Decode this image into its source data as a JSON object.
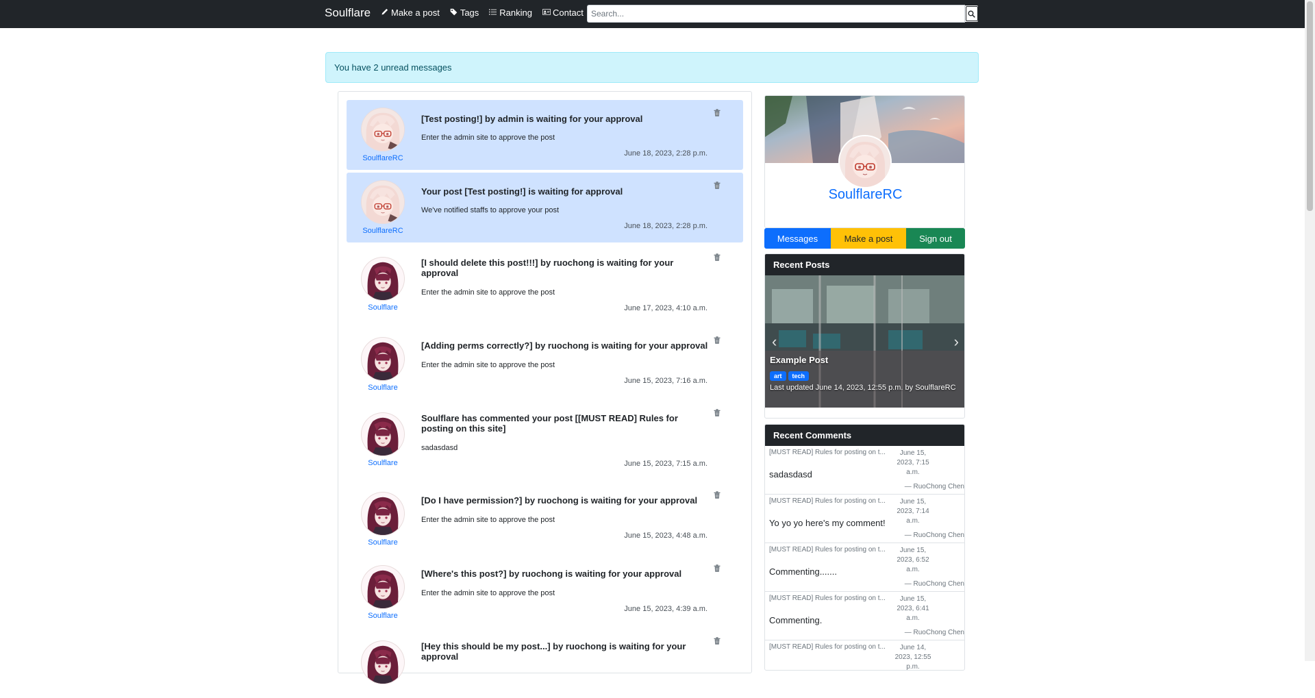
{
  "navbar": {
    "brand": "Soulflare",
    "links": [
      {
        "label": "Make a post",
        "icon": "pencil-icon"
      },
      {
        "label": "Tags",
        "icon": "tag-icon"
      },
      {
        "label": "Ranking",
        "icon": "list-icon"
      },
      {
        "label": "Contact",
        "icon": "contact-card-icon"
      }
    ],
    "search_placeholder": "Search..."
  },
  "alert": {
    "text": "You have 2 unread messages"
  },
  "messages": [
    {
      "title": "[Test posting!] by admin is waiting for your approval",
      "body": "Enter the admin site to approve the post",
      "time": "June 18, 2023, 2:28 p.m.",
      "user": "SoulflareRC",
      "unread": true
    },
    {
      "title": "Your post [Test posting!] is waiting for approval",
      "body": "We've notified staffs to approve your post",
      "time": "June 18, 2023, 2:28 p.m.",
      "user": "SoulflareRC",
      "unread": true
    },
    {
      "title": "[I should delete this post!!!] by ruochong is waiting for your approval",
      "body": "Enter the admin site to approve the post",
      "time": "June 17, 2023, 4:10 a.m.",
      "user": "Soulflare",
      "unread": false
    },
    {
      "title": "[Adding perms correctly?] by ruochong is waiting for your approval",
      "body": "Enter the admin site to approve the post",
      "time": "June 15, 2023, 7:16 a.m.",
      "user": "Soulflare",
      "unread": false
    },
    {
      "title": "Soulflare has commented your post [[MUST READ] Rules for posting on this site]",
      "body": "sadasdasd",
      "time": "June 15, 2023, 7:15 a.m.",
      "user": "Soulflare",
      "unread": false
    },
    {
      "title": "[Do I have permission?] by ruochong is waiting for your approval",
      "body": "Enter the admin site to approve the post",
      "time": "June 15, 2023, 4:48 a.m.",
      "user": "Soulflare",
      "unread": false
    },
    {
      "title": "[Where's this post?] by ruochong is waiting for your approval",
      "body": "Enter the admin site to approve the post",
      "time": "June 15, 2023, 4:39 a.m.",
      "user": "Soulflare",
      "unread": false
    },
    {
      "title": "[Hey this should be my post...] by ruochong is waiting for your approval",
      "body": "",
      "time": "",
      "user": "",
      "unread": false
    }
  ],
  "profile": {
    "name": "SoulflareRC",
    "buttons": {
      "messages": "Messages",
      "make_post": "Make a post",
      "sign_out": "Sign out"
    }
  },
  "recent_posts": {
    "header": "Recent Posts",
    "slide": {
      "title": "Example Post",
      "tags": [
        "art",
        "tech"
      ],
      "meta": "Last updated June 14, 2023, 12:55 p.m. by SoulflareRC"
    }
  },
  "recent_comments": {
    "header": "Recent Comments",
    "items": [
      {
        "post": "[MUST READ] Rules for posting on t...",
        "date": "June 15, 2023, 7:15 a.m.",
        "text": "sadasdasd",
        "author": "— RuoChong Chen"
      },
      {
        "post": "[MUST READ] Rules for posting on t...",
        "date": "June 15, 2023, 7:14 a.m.",
        "text": "Yo yo yo here's my comment!",
        "author": "— RuoChong Chen"
      },
      {
        "post": "[MUST READ] Rules for posting on t...",
        "date": "June 15, 2023, 6:52 a.m.",
        "text": "Commenting.......",
        "author": "— RuoChong Chen"
      },
      {
        "post": "[MUST READ] Rules for posting on t...",
        "date": "June 15, 2023, 6:41 a.m.",
        "text": "Commenting.",
        "author": "— RuoChong Chen"
      },
      {
        "post": "[MUST READ] Rules for posting on t...",
        "date": "June 14, 2023, 12:55 p.m.",
        "text": "",
        "author": ""
      }
    ]
  },
  "colors": {
    "navbar": "#212529",
    "accent": "#0d6efd",
    "unread_bg": "#cfe2ff",
    "alert_bg": "#cff4fc",
    "warning": "#ffc107",
    "success": "#198754"
  }
}
